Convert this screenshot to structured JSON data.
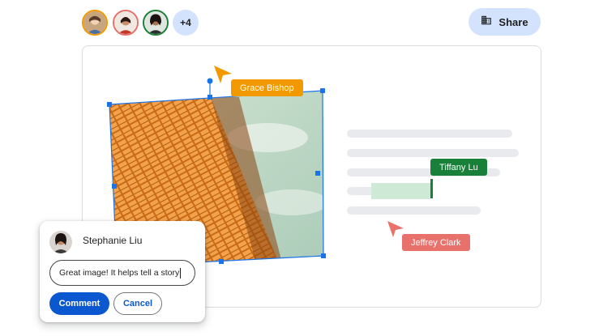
{
  "collaborators": {
    "avatars": [
      {
        "name": "avatar-1",
        "ring": "#f29900",
        "bg": "#c7a57e"
      },
      {
        "name": "avatar-2",
        "ring": "#e8716b",
        "bg": "#8f5b4a"
      },
      {
        "name": "avatar-3",
        "ring": "#188038",
        "bg": "#6b4a3a"
      }
    ],
    "more_label": "+4"
  },
  "header": {
    "share_label": "Share",
    "share_icon": "domain-building-icon"
  },
  "cursors": {
    "grace": {
      "label": "Grace Bishop",
      "color": "#f29900"
    },
    "tiffany": {
      "label": "Tiffany Lu",
      "color": "#188038"
    },
    "jeffrey": {
      "label": "Jeffrey Clark",
      "color": "#e8716b"
    }
  },
  "image": {
    "selection_color": "#1a73e8"
  },
  "comment": {
    "user": "Stephanie Liu",
    "input_value": "Great image! It helps tell a story",
    "comment_label": "Comment",
    "cancel_label": "Cancel"
  },
  "colors": {
    "primary": "#0b57d0",
    "share_bg": "#d3e3fd",
    "highlight": "#ceead6"
  }
}
